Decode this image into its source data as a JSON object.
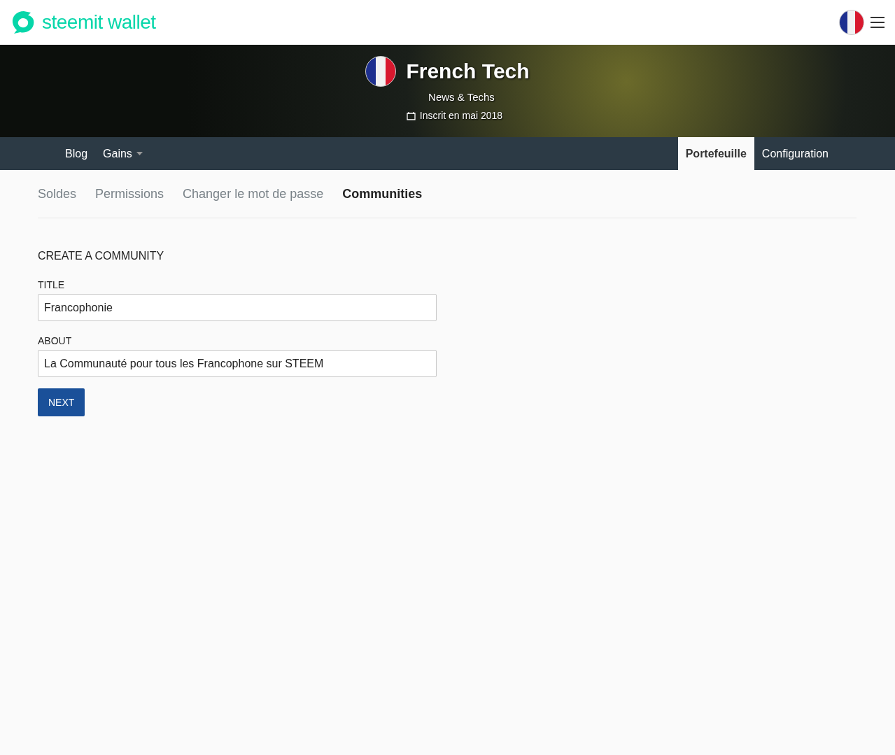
{
  "header": {
    "logo": "steemit wallet"
  },
  "profile": {
    "name": "French Tech",
    "about": "News & Techs",
    "joined": "Inscrit en mai 2018"
  },
  "nav_left": [
    {
      "label": "Blog",
      "dropdown": false
    },
    {
      "label": "Gains",
      "dropdown": true
    }
  ],
  "nav_right": [
    {
      "label": "Portefeuille",
      "selected": true
    },
    {
      "label": "Configuration",
      "selected": false
    }
  ],
  "subtabs": [
    {
      "label": "Soldes",
      "selected": false
    },
    {
      "label": "Permissions",
      "selected": false
    },
    {
      "label": "Changer le mot de passe",
      "selected": false
    },
    {
      "label": "Communities",
      "selected": true
    }
  ],
  "form": {
    "heading": "CREATE A COMMUNITY",
    "fields": [
      {
        "label": "TITLE",
        "value": "Francophonie"
      },
      {
        "label": "ABOUT",
        "value": "La Communauté pour tous les Francophone sur STEEM"
      }
    ],
    "button": "NEXT"
  }
}
